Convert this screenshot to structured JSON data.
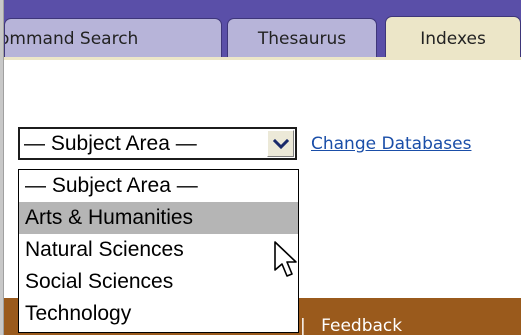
{
  "tabs": [
    {
      "label": "Command Search",
      "shown": "ommand Search",
      "active": false
    },
    {
      "label": "Thesaurus",
      "active": false
    },
    {
      "label": "Indexes",
      "active": true
    }
  ],
  "subject_select": {
    "selected": "— Subject Area —",
    "options": [
      "— Subject Area —",
      "Arts & Humanities",
      "Natural Sciences",
      "Social Sciences",
      "Technology"
    ],
    "hovered_index": 1
  },
  "change_databases_label": "Change Databases",
  "footer": {
    "separator": "|",
    "feedback_label": "Feedback"
  },
  "colors": {
    "tabbar": "#5a4fa8",
    "tab_inactive": "#b7b4d9",
    "tab_active": "#ece6c8",
    "link": "#1a4ea8",
    "footer": "#9a5a1c",
    "highlight": "#b5b5b5"
  }
}
